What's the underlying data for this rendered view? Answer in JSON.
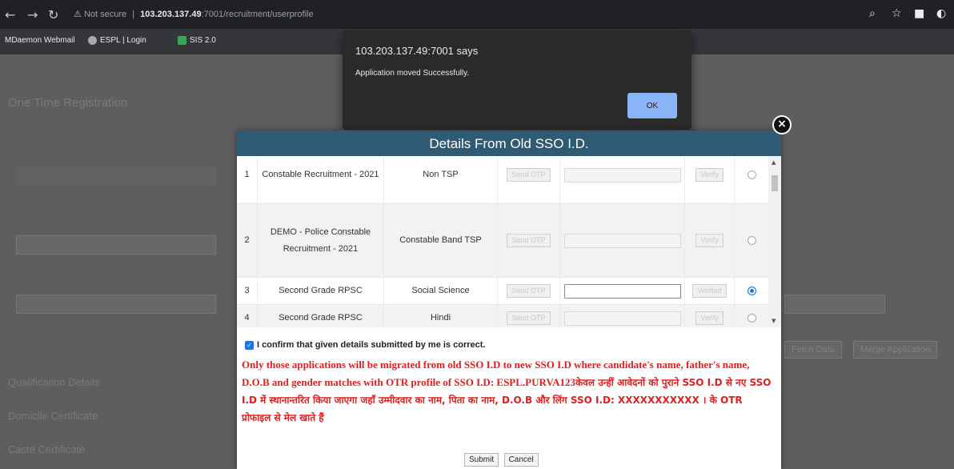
{
  "browser": {
    "address_warning": "Not secure",
    "address_host": "103.203.137.49",
    "address_path": ":7001/recruitment/userprofile",
    "bookmarks": [
      "MDaemon Webmail",
      "ESPL | Login",
      "SIS 2.0"
    ]
  },
  "background_page": {
    "section_title": "One Time Registration",
    "side_items": [
      "Qualification Details",
      "Domicile Certificate",
      "Caste Certificate"
    ],
    "buttons": [
      "Fetch Data",
      "Merge Application"
    ]
  },
  "alert": {
    "title": "103.203.137.49:7001 says",
    "message": "Application moved Successfully.",
    "ok_label": "OK"
  },
  "modal": {
    "title": "Details From Old SSO I.D.",
    "send_otp_label": "Send OTP",
    "verify_label": "Verify",
    "verified_label": "Verified",
    "rows": [
      {
        "num": "1",
        "name": "Constable Recruitment - 2021",
        "category": "Non TSP",
        "selected": false
      },
      {
        "num": "2",
        "name": "DEMO - Police Constable Recruitment - 2021",
        "category": "Constable Band TSP",
        "selected": false
      },
      {
        "num": "3",
        "name": "Second Grade RPSC",
        "category": "Social Science",
        "selected": true
      },
      {
        "num": "4",
        "name": "Second Grade RPSC",
        "category": "Hindi",
        "selected": false
      }
    ],
    "confirm_text": "I confirm that given details submitted by me is correct.",
    "notice_en": "Only those applications will be migrated from old SSO I.D to new SSO I.D where candidate's name, father's name, D.O.B and gender matches with OTR profile of SSO I.D: ESPL.PURVA123",
    "notice_hi": "केवल उन्हीं आवेदनों को पुराने SSO I.D से नए SSO I.D में स्थानान्तरित किया जाएगा जहाँ उम्मीदवार का नाम, पिता का नाम, D.O.B और लिंग SSO I.D: XXXXXXXXXXX । के OTR प्रोफाइल से मेल खाते हैं",
    "submit_label": "Submit",
    "cancel_label": "Cancel"
  }
}
